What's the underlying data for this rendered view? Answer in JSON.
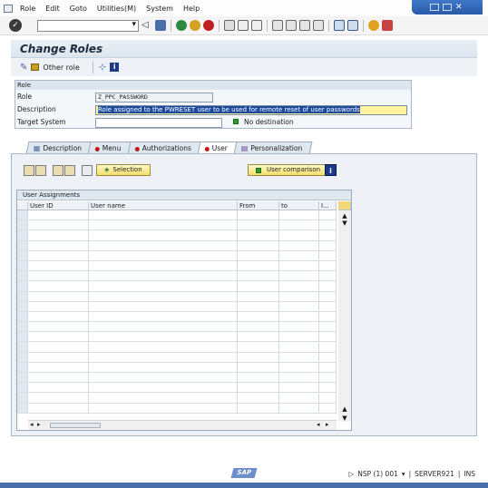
{
  "menu": {
    "items": [
      "Role",
      "Edit",
      "Goto",
      "Utilities(M)",
      "System",
      "Help"
    ]
  },
  "title": "Change Roles",
  "app_toolbar": {
    "other_role_label": "Other role"
  },
  "role_group": {
    "header": "Role",
    "role_label": "Role",
    "role_value": "Z_PPC_PASSWORD",
    "description_label": "Description",
    "description_value": "Role assigned to the PWRESET user to be used for remote reset of user passwords",
    "target_system_label": "Target System",
    "target_system_value": "",
    "destination_status": "No destination"
  },
  "tabs": [
    {
      "label": "Description",
      "status": "icon",
      "active": false
    },
    {
      "label": "Menu",
      "status": "red",
      "active": false
    },
    {
      "label": "Authorizations",
      "status": "red",
      "active": false
    },
    {
      "label": "User",
      "status": "red",
      "active": true
    },
    {
      "label": "Personalization",
      "status": "icon",
      "active": false
    }
  ],
  "panel": {
    "selection_button": "Selection",
    "user_comparison_button": "User comparison"
  },
  "table": {
    "title": "User Assignments",
    "columns": [
      "User ID",
      "User name",
      "From",
      "to",
      "I..."
    ],
    "rows": 20
  },
  "statusbar": {
    "sap_badge": "SAP",
    "system": "NSP (1) 001",
    "server": "SERVER921",
    "mode": "INS"
  },
  "colors": {
    "title_bg": "#e4ebf3",
    "description_highlight": "#fff5a0",
    "selection_bg": "#1b4a9c",
    "status_red": "#c01818",
    "status_green": "#2e9e2e"
  }
}
